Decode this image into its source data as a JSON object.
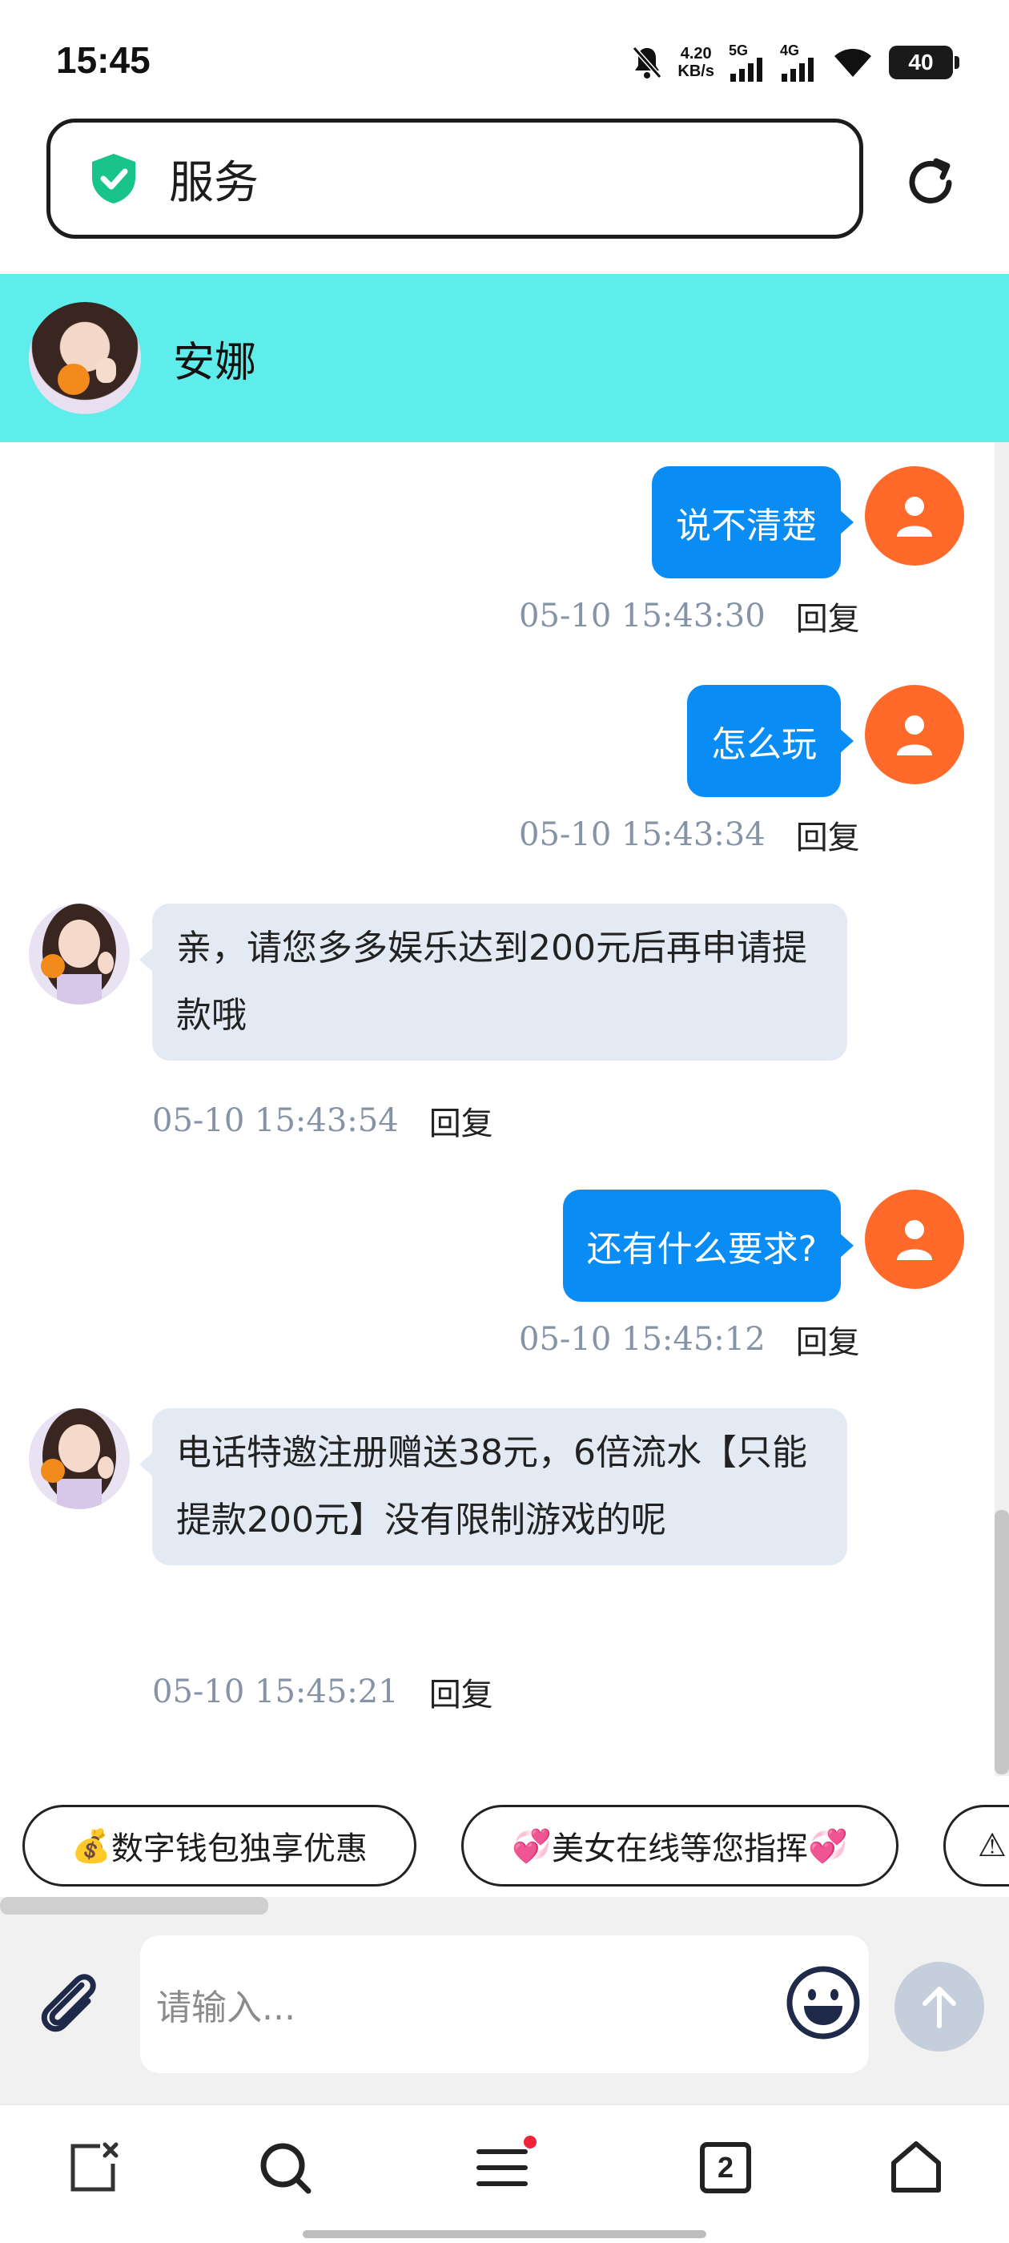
{
  "status_bar": {
    "time": "15:45",
    "net_speed_value": "4.20",
    "net_speed_unit": "KB/s",
    "signal_1": "5G",
    "signal_2": "4G",
    "battery": "40"
  },
  "address_bar": {
    "title": "服务",
    "shield_color": "#18c48a"
  },
  "chat": {
    "contact_name": "安娜",
    "messages": [
      {
        "side": "out",
        "text": "说不清楚",
        "time": "05-10 15:43:30",
        "reply": "回复"
      },
      {
        "side": "out",
        "text": "怎么玩",
        "time": "05-10 15:43:34",
        "reply": "回复"
      },
      {
        "side": "in",
        "text": "亲，请您多多娱乐达到200元后再申请提款哦",
        "time": "05-10 15:43:54",
        "reply": "回复"
      },
      {
        "side": "out",
        "text": "还有什么要求?",
        "time": "05-10 15:45:12",
        "reply": "回复"
      },
      {
        "side": "in",
        "text": "电话特邀注册赠送38元，6倍流水【只能提款200元】没有限制游戏的呢",
        "time": "05-10 15:45:21",
        "reply": "回复"
      }
    ]
  },
  "quick_replies": [
    {
      "icon": "💰",
      "label": "数字钱包独享优惠"
    },
    {
      "icon": "💞",
      "label": "美女在线等您指挥",
      "suffix": "💞"
    },
    {
      "icon": "⚠",
      "label": ""
    }
  ],
  "input": {
    "placeholder": "请输入..."
  },
  "bottom_nav": {
    "tabs_count": "2"
  },
  "colors": {
    "header_bg": "#5eedeb",
    "outgoing_bubble": "#0a8cf5",
    "incoming_bubble": "#e4eaf3",
    "user_avatar": "#ff6a2a",
    "timestamp": "#8593a6"
  }
}
